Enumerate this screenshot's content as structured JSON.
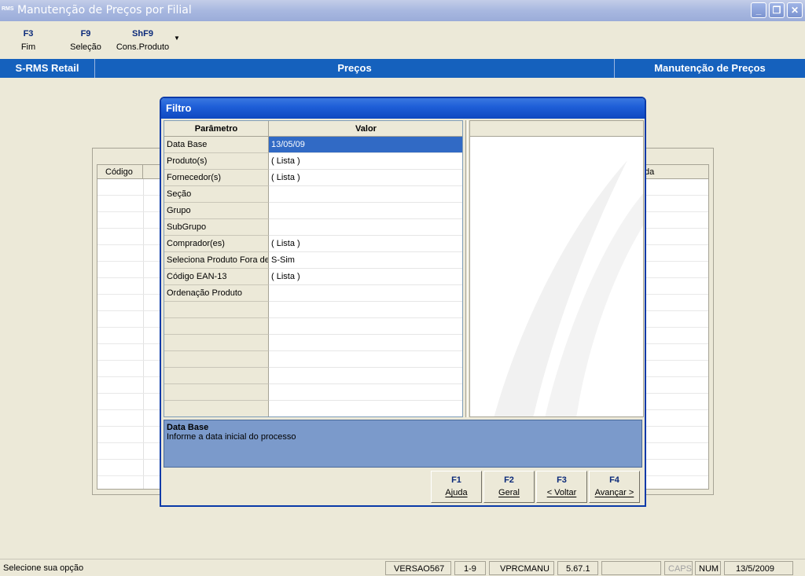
{
  "window": {
    "icon_text": "RMS",
    "title": "Manutenção de Preços por Filial",
    "min_glyph": "_",
    "restore_glyph": "❐",
    "close_glyph": "✕"
  },
  "toolbar": {
    "items": [
      {
        "key": "F3",
        "label": "Fim"
      },
      {
        "key": "F9",
        "label": "Seleção"
      },
      {
        "key": "ShF9",
        "label": "Cons.Produto"
      }
    ],
    "more_glyph": "▼"
  },
  "header_band": {
    "left": "S-RMS Retail",
    "center": "Preços",
    "right": "Manutenção de Preços"
  },
  "background_grid": {
    "col_first": "Código",
    "col_last_partial": "da"
  },
  "dialog": {
    "title": "Filtro",
    "grid": {
      "header_param": "Parâmetro",
      "header_value": "Valor",
      "rows": [
        {
          "param": "Data Base",
          "value": "13/05/09"
        },
        {
          "param": "Produto(s)",
          "value": "( Lista )"
        },
        {
          "param": "Fornecedor(s)",
          "value": "( Lista )"
        },
        {
          "param": "Seção",
          "value": ""
        },
        {
          "param": "Grupo",
          "value": ""
        },
        {
          "param": "SubGrupo",
          "value": ""
        },
        {
          "param": "Comprador(es)",
          "value": "( Lista )"
        },
        {
          "param": "Seleciona Produto Fora de",
          "value": "S-Sim"
        },
        {
          "param": "Código EAN-13",
          "value": "( Lista )"
        },
        {
          "param": "Ordenação Produto",
          "value": ""
        },
        {
          "param": "",
          "value": ""
        },
        {
          "param": "",
          "value": ""
        },
        {
          "param": "",
          "value": ""
        },
        {
          "param": "",
          "value": ""
        },
        {
          "param": "",
          "value": ""
        },
        {
          "param": "",
          "value": ""
        },
        {
          "param": "",
          "value": ""
        }
      ]
    },
    "help": {
      "title": "Data Base",
      "text": "Informe a data inicial do processo"
    },
    "buttons": [
      {
        "key": "F1",
        "label": "Ajuda"
      },
      {
        "key": "F2",
        "label": "Geral"
      },
      {
        "key": "F3",
        "label": "< Voltar"
      },
      {
        "key": "F4",
        "label": "Avançar >"
      }
    ]
  },
  "statusbar": {
    "message": "Selecione sua opção",
    "version": "VERSAO567",
    "range": "1-9",
    "program": "VPRCMANU",
    "build": "5.67.1",
    "blank": "",
    "caps": "CAPS",
    "num": "NUM",
    "date": "13/5/2009"
  },
  "colors": {
    "band": "#1561bd",
    "selection": "#316ac5",
    "help_bg": "#7b9acb",
    "dialog_border": "#0a3aa8"
  }
}
